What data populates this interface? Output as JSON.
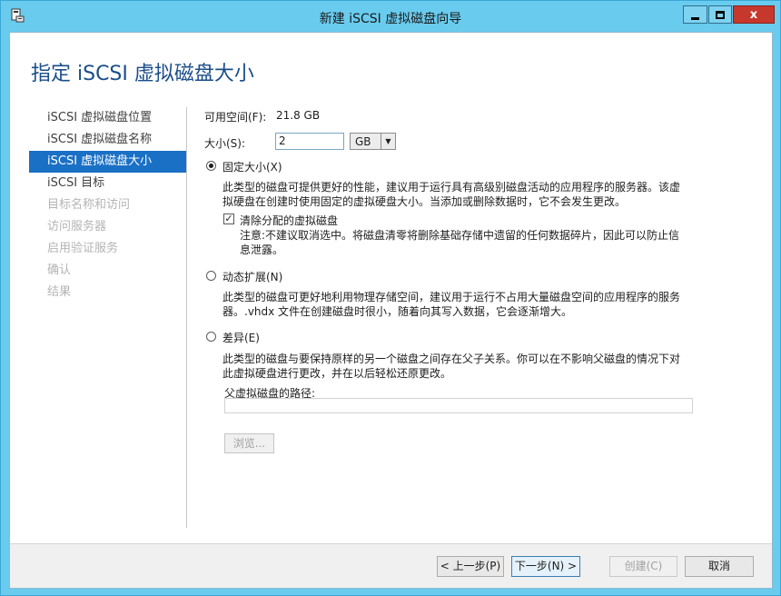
{
  "window": {
    "title": "新建 iSCSI 虚拟磁盘向导",
    "close_glyph": "x"
  },
  "page": {
    "title": "指定 iSCSI 虚拟磁盘大小"
  },
  "nav": {
    "items": [
      {
        "label": "iSCSI 虚拟磁盘位置",
        "state": "normal"
      },
      {
        "label": "iSCSI 虚拟磁盘名称",
        "state": "normal"
      },
      {
        "label": "iSCSI 虚拟磁盘大小",
        "state": "active"
      },
      {
        "label": "iSCSI 目标",
        "state": "normal"
      },
      {
        "label": "目标名称和访问",
        "state": "disabled"
      },
      {
        "label": "访问服务器",
        "state": "disabled"
      },
      {
        "label": "启用验证服务",
        "state": "disabled"
      },
      {
        "label": "确认",
        "state": "disabled"
      },
      {
        "label": "结果",
        "state": "disabled"
      }
    ]
  },
  "content": {
    "free_space_label": "可用空间(F):",
    "free_space_value": "21.8 GB",
    "size_label": "大小(S):",
    "size_value": "2",
    "size_unit": "GB",
    "options": {
      "fixed": {
        "label": "固定大小(X)",
        "checked": true,
        "desc_line1": "此类型的磁盘可提供更好的性能，建议用于运行具有高级别磁盘活动的应用程序的服务器。该虚",
        "desc_line2": "拟硬盘在创建时使用固定的虚拟硬盘大小。当添加或删除数据时，它不会发生更改。",
        "clear_checkbox": {
          "label": "清除分配的虚拟磁盘",
          "checked": true,
          "note_line1": "注意:不建议取消选中。将磁盘清零将删除基础存储中遗留的任何数据碎片，因此可以防止信",
          "note_line2": "息泄露。"
        }
      },
      "dynamic": {
        "label": "动态扩展(N)",
        "checked": false,
        "desc_line1": "此类型的磁盘可更好地利用物理存储空间，建议用于运行不占用大量磁盘空间的应用程序的服务",
        "desc_line2": "器。.vhdx 文件在创建磁盘时很小，随着向其写入数据，它会逐渐增大。"
      },
      "differencing": {
        "label": "差异(E)",
        "checked": false,
        "desc_line1": "此类型的磁盘与要保持原样的另一个磁盘之间存在父子关系。你可以在不影响父磁盘的情况下对",
        "desc_line2": "此虚拟硬盘进行更改，并在以后轻松还原更改。",
        "parent_path_label": "父虚拟磁盘的路径:",
        "parent_path_value": "",
        "browse_label": "浏览..."
      }
    }
  },
  "footer": {
    "prev_label": "< 上一步(P)",
    "next_label": "下一步(N) >",
    "create_label": "创建(C)",
    "cancel_label": "取消"
  }
}
